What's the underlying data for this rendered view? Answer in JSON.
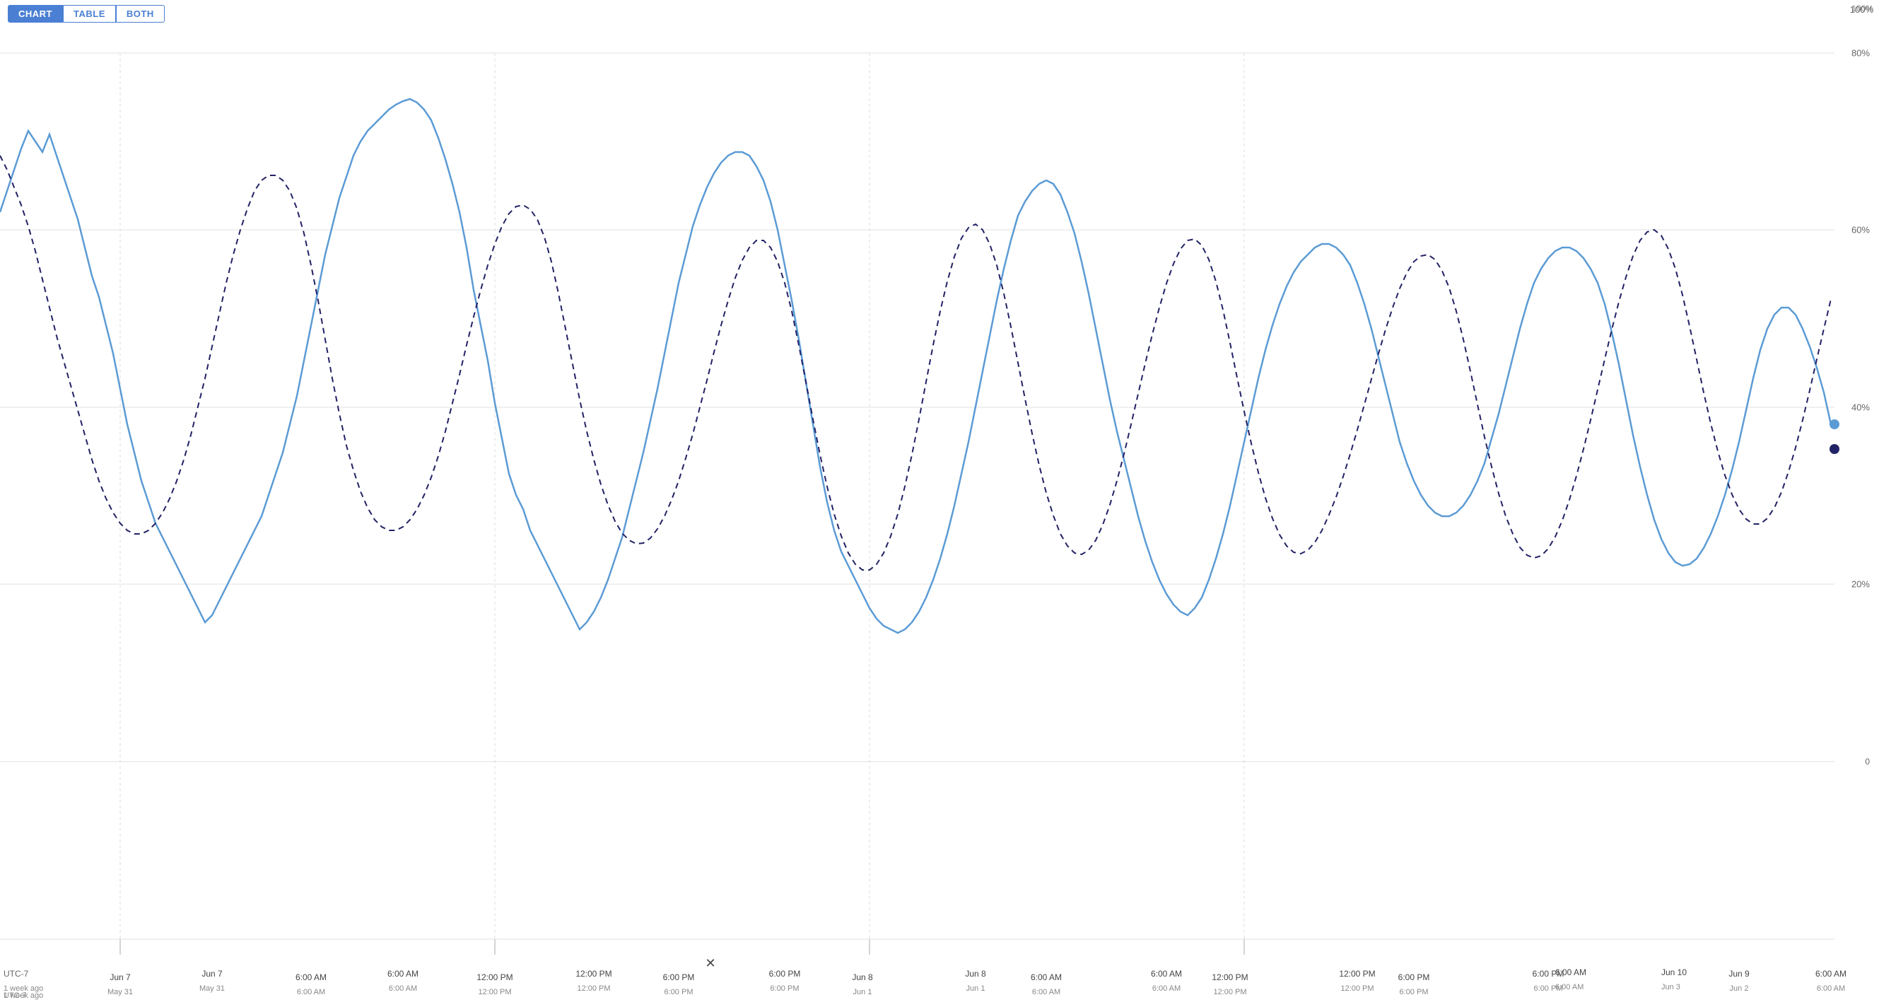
{
  "tabs": [
    {
      "label": "CHART",
      "active": true
    },
    {
      "label": "TABLE",
      "active": false
    },
    {
      "label": "BOTH",
      "active": false
    }
  ],
  "yAxis": {
    "labels": [
      {
        "value": "100%",
        "pct": 100
      },
      {
        "value": "80%",
        "pct": 80
      },
      {
        "value": "60%",
        "pct": 60
      },
      {
        "value": "40%",
        "pct": 40
      },
      {
        "value": "20%",
        "pct": 20
      },
      {
        "value": "0",
        "pct": 0
      }
    ]
  },
  "xAxis": {
    "timezone": "UTC-7",
    "labels": [
      {
        "primary": "Jun 7",
        "secondary": "May 31",
        "pct": 6.5
      },
      {
        "primary": "6:00 AM",
        "secondary": "6:00 AM",
        "pct": 11.5
      },
      {
        "primary": "12:00 PM",
        "secondary": "12:00 PM",
        "pct": 16.5
      },
      {
        "primary": "6:00 PM",
        "secondary": "6:00 PM",
        "pct": 21.5
      },
      {
        "primary": "Jun 8",
        "secondary": "Jun 1",
        "pct": 26.5
      },
      {
        "primary": "6:00 AM",
        "secondary": "6:00 AM",
        "pct": 31.5
      },
      {
        "primary": "12:00 PM",
        "secondary": "12:00 PM",
        "pct": 36.5
      },
      {
        "primary": "6:00 PM",
        "secondary": "6:00 PM",
        "pct": 41.5
      },
      {
        "primary": "Jun 9",
        "secondary": "Jun 2",
        "pct": 46.5
      },
      {
        "primary": "6:00 AM",
        "secondary": "6:00 AM",
        "pct": 51.5
      },
      {
        "primary": "12:00 PM",
        "secondary": "12:00 PM",
        "pct": 56.5
      },
      {
        "primary": "6:00 PM",
        "secondary": "6:00 PM",
        "pct": 61.5
      },
      {
        "primary": "Jun 10",
        "secondary": "Jun 3",
        "pct": 66.5
      },
      {
        "primary": "6:00 AM",
        "secondary": "6:00 AM",
        "pct": 71.5
      }
    ]
  },
  "chart": {
    "colors": {
      "solid_line": "#5b9bd5",
      "dashed_line": "#222266",
      "grid": "#e0e0e0"
    }
  },
  "footer": {
    "period_label": "1 week ago"
  }
}
